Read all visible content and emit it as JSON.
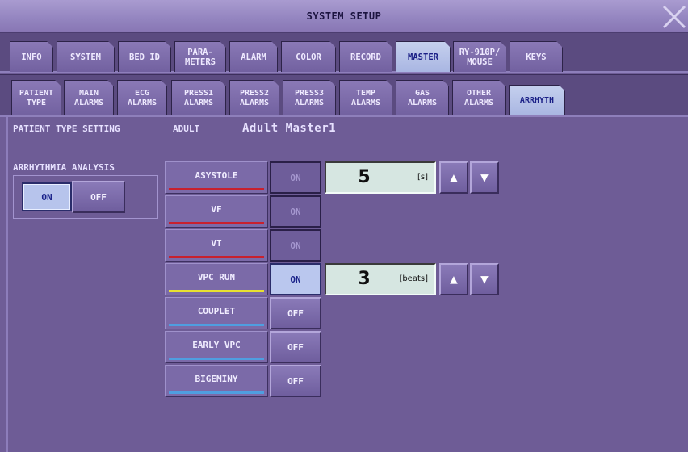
{
  "window": {
    "title": "SYSTEM SETUP"
  },
  "tabs_row1": [
    {
      "label": "INFO",
      "active": false
    },
    {
      "label": "SYSTEM",
      "active": false
    },
    {
      "label": "BED ID",
      "active": false
    },
    {
      "label": "PARA-\nMETERS",
      "active": false
    },
    {
      "label": "ALARM",
      "active": false
    },
    {
      "label": "COLOR",
      "active": false
    },
    {
      "label": "RECORD",
      "active": false
    },
    {
      "label": "MASTER",
      "active": true
    },
    {
      "label": "RY-910P/\nMOUSE",
      "active": false
    },
    {
      "label": "KEYS",
      "active": false
    }
  ],
  "tabs_row2": [
    {
      "label": "PATIENT\nTYPE",
      "active": false
    },
    {
      "label": "MAIN\nALARMS",
      "active": false
    },
    {
      "label": "ECG\nALARMS",
      "active": false
    },
    {
      "label": "PRESS1\nALARMS",
      "active": false
    },
    {
      "label": "PRESS2\nALARMS",
      "active": false
    },
    {
      "label": "PRESS3\nALARMS",
      "active": false
    },
    {
      "label": "TEMP\nALARMS",
      "active": false
    },
    {
      "label": "GAS\nALARMS",
      "active": false
    },
    {
      "label": "OTHER\nALARMS",
      "active": false
    },
    {
      "label": "ARRHYTH",
      "active": true
    }
  ],
  "patient_type": {
    "label": "PATIENT TYPE SETTING",
    "value": "ADULT",
    "master_name": "Adult Master1"
  },
  "arrhythmia_analysis": {
    "label": "ARRHYTHMIA ANALYSIS",
    "on_label": "ON",
    "off_label": "OFF",
    "selected": "ON"
  },
  "alarms": [
    {
      "name": "ASYSTOLE",
      "state": "ON",
      "state_style": "dim",
      "bar_color": "#c8202e",
      "value": "5",
      "unit": "[s]",
      "has_stepper": true
    },
    {
      "name": "VF",
      "state": "ON",
      "state_style": "dim",
      "bar_color": "#c8202e",
      "has_stepper": false
    },
    {
      "name": "VT",
      "state": "ON",
      "state_style": "dim",
      "bar_color": "#c8202e",
      "has_stepper": false
    },
    {
      "name": "VPC RUN",
      "state": "ON",
      "state_style": "bright",
      "bar_color": "#e8e030",
      "value": "3",
      "unit": "[beats]",
      "has_stepper": true
    },
    {
      "name": "COUPLET",
      "state": "OFF",
      "state_style": "off",
      "bar_color": "#4f9ee0",
      "has_stepper": false
    },
    {
      "name": "EARLY VPC",
      "state": "OFF",
      "state_style": "off",
      "bar_color": "#4f9ee0",
      "has_stepper": false
    },
    {
      "name": "BIGEMINY",
      "state": "OFF",
      "state_style": "off",
      "bar_color": "#4f9ee0",
      "has_stepper": false
    }
  ],
  "stepper": {
    "up_icon": "triangle-up-icon",
    "down_icon": "triangle-down-icon"
  },
  "colors": {
    "active_tab": "#b7c4ec",
    "active_text": "#1b238a",
    "value_box": "#d6e6e1"
  }
}
